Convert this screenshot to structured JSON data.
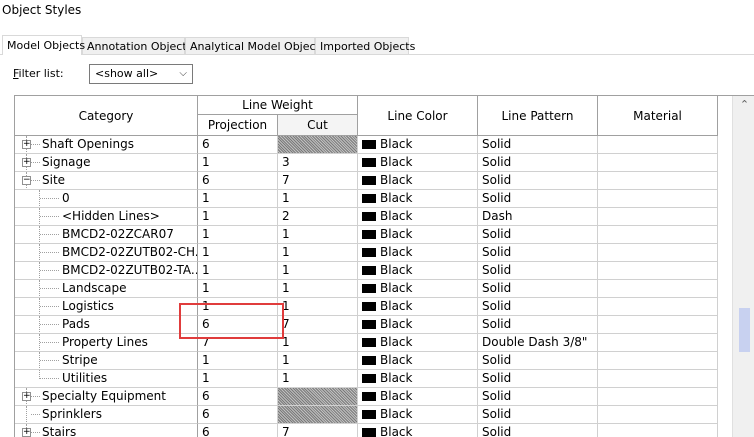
{
  "window": {
    "title": "Object Styles"
  },
  "tabs": [
    {
      "label": "Model Objects",
      "active": true
    },
    {
      "label": "Annotation Objects",
      "active": false
    },
    {
      "label": "Analytical Model Objects",
      "active": false
    },
    {
      "label": "Imported Objects",
      "active": false
    }
  ],
  "filter": {
    "label_prefix": "F",
    "label_rest": "ilter list:",
    "selected": "<show all>",
    "chevron": "⌵"
  },
  "table": {
    "headers": {
      "category": "Category",
      "line_weight": "Line Weight",
      "projection": "Projection",
      "cut": "Cut",
      "line_color": "Line Color",
      "line_pattern": "Line Pattern",
      "material": "Material"
    },
    "rows": [
      {
        "category": "Shaft Openings",
        "level": 0,
        "expander": "+",
        "projection": "6",
        "cut": "",
        "cut_hatched": true,
        "color": "Black",
        "pattern": "Solid",
        "material": ""
      },
      {
        "category": "Signage",
        "level": 0,
        "expander": "+",
        "projection": "1",
        "cut": "3",
        "cut_hatched": false,
        "color": "Black",
        "pattern": "Solid",
        "material": ""
      },
      {
        "category": "Site",
        "level": 0,
        "expander": "−",
        "projection": "6",
        "cut": "7",
        "cut_hatched": false,
        "color": "Black",
        "pattern": "Solid",
        "material": ""
      },
      {
        "category": "0",
        "level": 1,
        "expander": "",
        "projection": "1",
        "cut": "1",
        "cut_hatched": false,
        "color": "Black",
        "pattern": "Solid",
        "material": ""
      },
      {
        "category": "<Hidden Lines>",
        "level": 1,
        "expander": "",
        "projection": "1",
        "cut": "2",
        "cut_hatched": false,
        "color": "Black",
        "pattern": "Dash",
        "material": ""
      },
      {
        "category": "BMCD2-02ZCAR07",
        "level": 1,
        "expander": "",
        "projection": "1",
        "cut": "1",
        "cut_hatched": false,
        "color": "Black",
        "pattern": "Solid",
        "material": ""
      },
      {
        "category": "BMCD2-02ZUTB02-CH...",
        "level": 1,
        "expander": "",
        "projection": "1",
        "cut": "1",
        "cut_hatched": false,
        "color": "Black",
        "pattern": "Solid",
        "material": ""
      },
      {
        "category": "BMCD2-02ZUTB02-TA...",
        "level": 1,
        "expander": "",
        "projection": "1",
        "cut": "1",
        "cut_hatched": false,
        "color": "Black",
        "pattern": "Solid",
        "material": ""
      },
      {
        "category": "Landscape",
        "level": 1,
        "expander": "",
        "projection": "1",
        "cut": "1",
        "cut_hatched": false,
        "color": "Black",
        "pattern": "Solid",
        "material": ""
      },
      {
        "category": "Logistics",
        "level": 1,
        "expander": "",
        "projection": "1",
        "cut": "1",
        "cut_hatched": false,
        "color": "Black",
        "pattern": "Solid",
        "material": ""
      },
      {
        "category": "Pads",
        "level": 1,
        "expander": "",
        "projection": "6",
        "cut": "7",
        "cut_hatched": false,
        "color": "Black",
        "pattern": "Solid",
        "material": ""
      },
      {
        "category": "Property Lines",
        "level": 1,
        "expander": "",
        "projection": "7",
        "cut": "1",
        "cut_hatched": false,
        "color": "Black",
        "pattern": "Double Dash 3/8\"",
        "material": ""
      },
      {
        "category": "Stripe",
        "level": 1,
        "expander": "",
        "projection": "1",
        "cut": "1",
        "cut_hatched": false,
        "color": "Black",
        "pattern": "Solid",
        "material": ""
      },
      {
        "category": "Utilities",
        "level": 1,
        "expander": "",
        "projection": "1",
        "cut": "1",
        "cut_hatched": false,
        "color": "Black",
        "pattern": "Solid",
        "material": ""
      },
      {
        "category": "Specialty Equipment",
        "level": 0,
        "expander": "+",
        "projection": "6",
        "cut": "",
        "cut_hatched": true,
        "color": "Black",
        "pattern": "Solid",
        "material": ""
      },
      {
        "category": "Sprinklers",
        "level": 0,
        "expander": "",
        "projection": "6",
        "cut": "",
        "cut_hatched": true,
        "color": "Black",
        "pattern": "Solid",
        "material": ""
      },
      {
        "category": "Stairs",
        "level": 0,
        "expander": "+",
        "projection": "6",
        "cut": "7",
        "cut_hatched": false,
        "color": "Black",
        "pattern": "Solid",
        "material": ""
      }
    ]
  },
  "scrollbar": {
    "up_arrow": "⌃"
  },
  "colors": {
    "highlight": "#e03c3c",
    "hatch": "#9a9a9a",
    "scroll_thumb": "#c8d1f0"
  }
}
